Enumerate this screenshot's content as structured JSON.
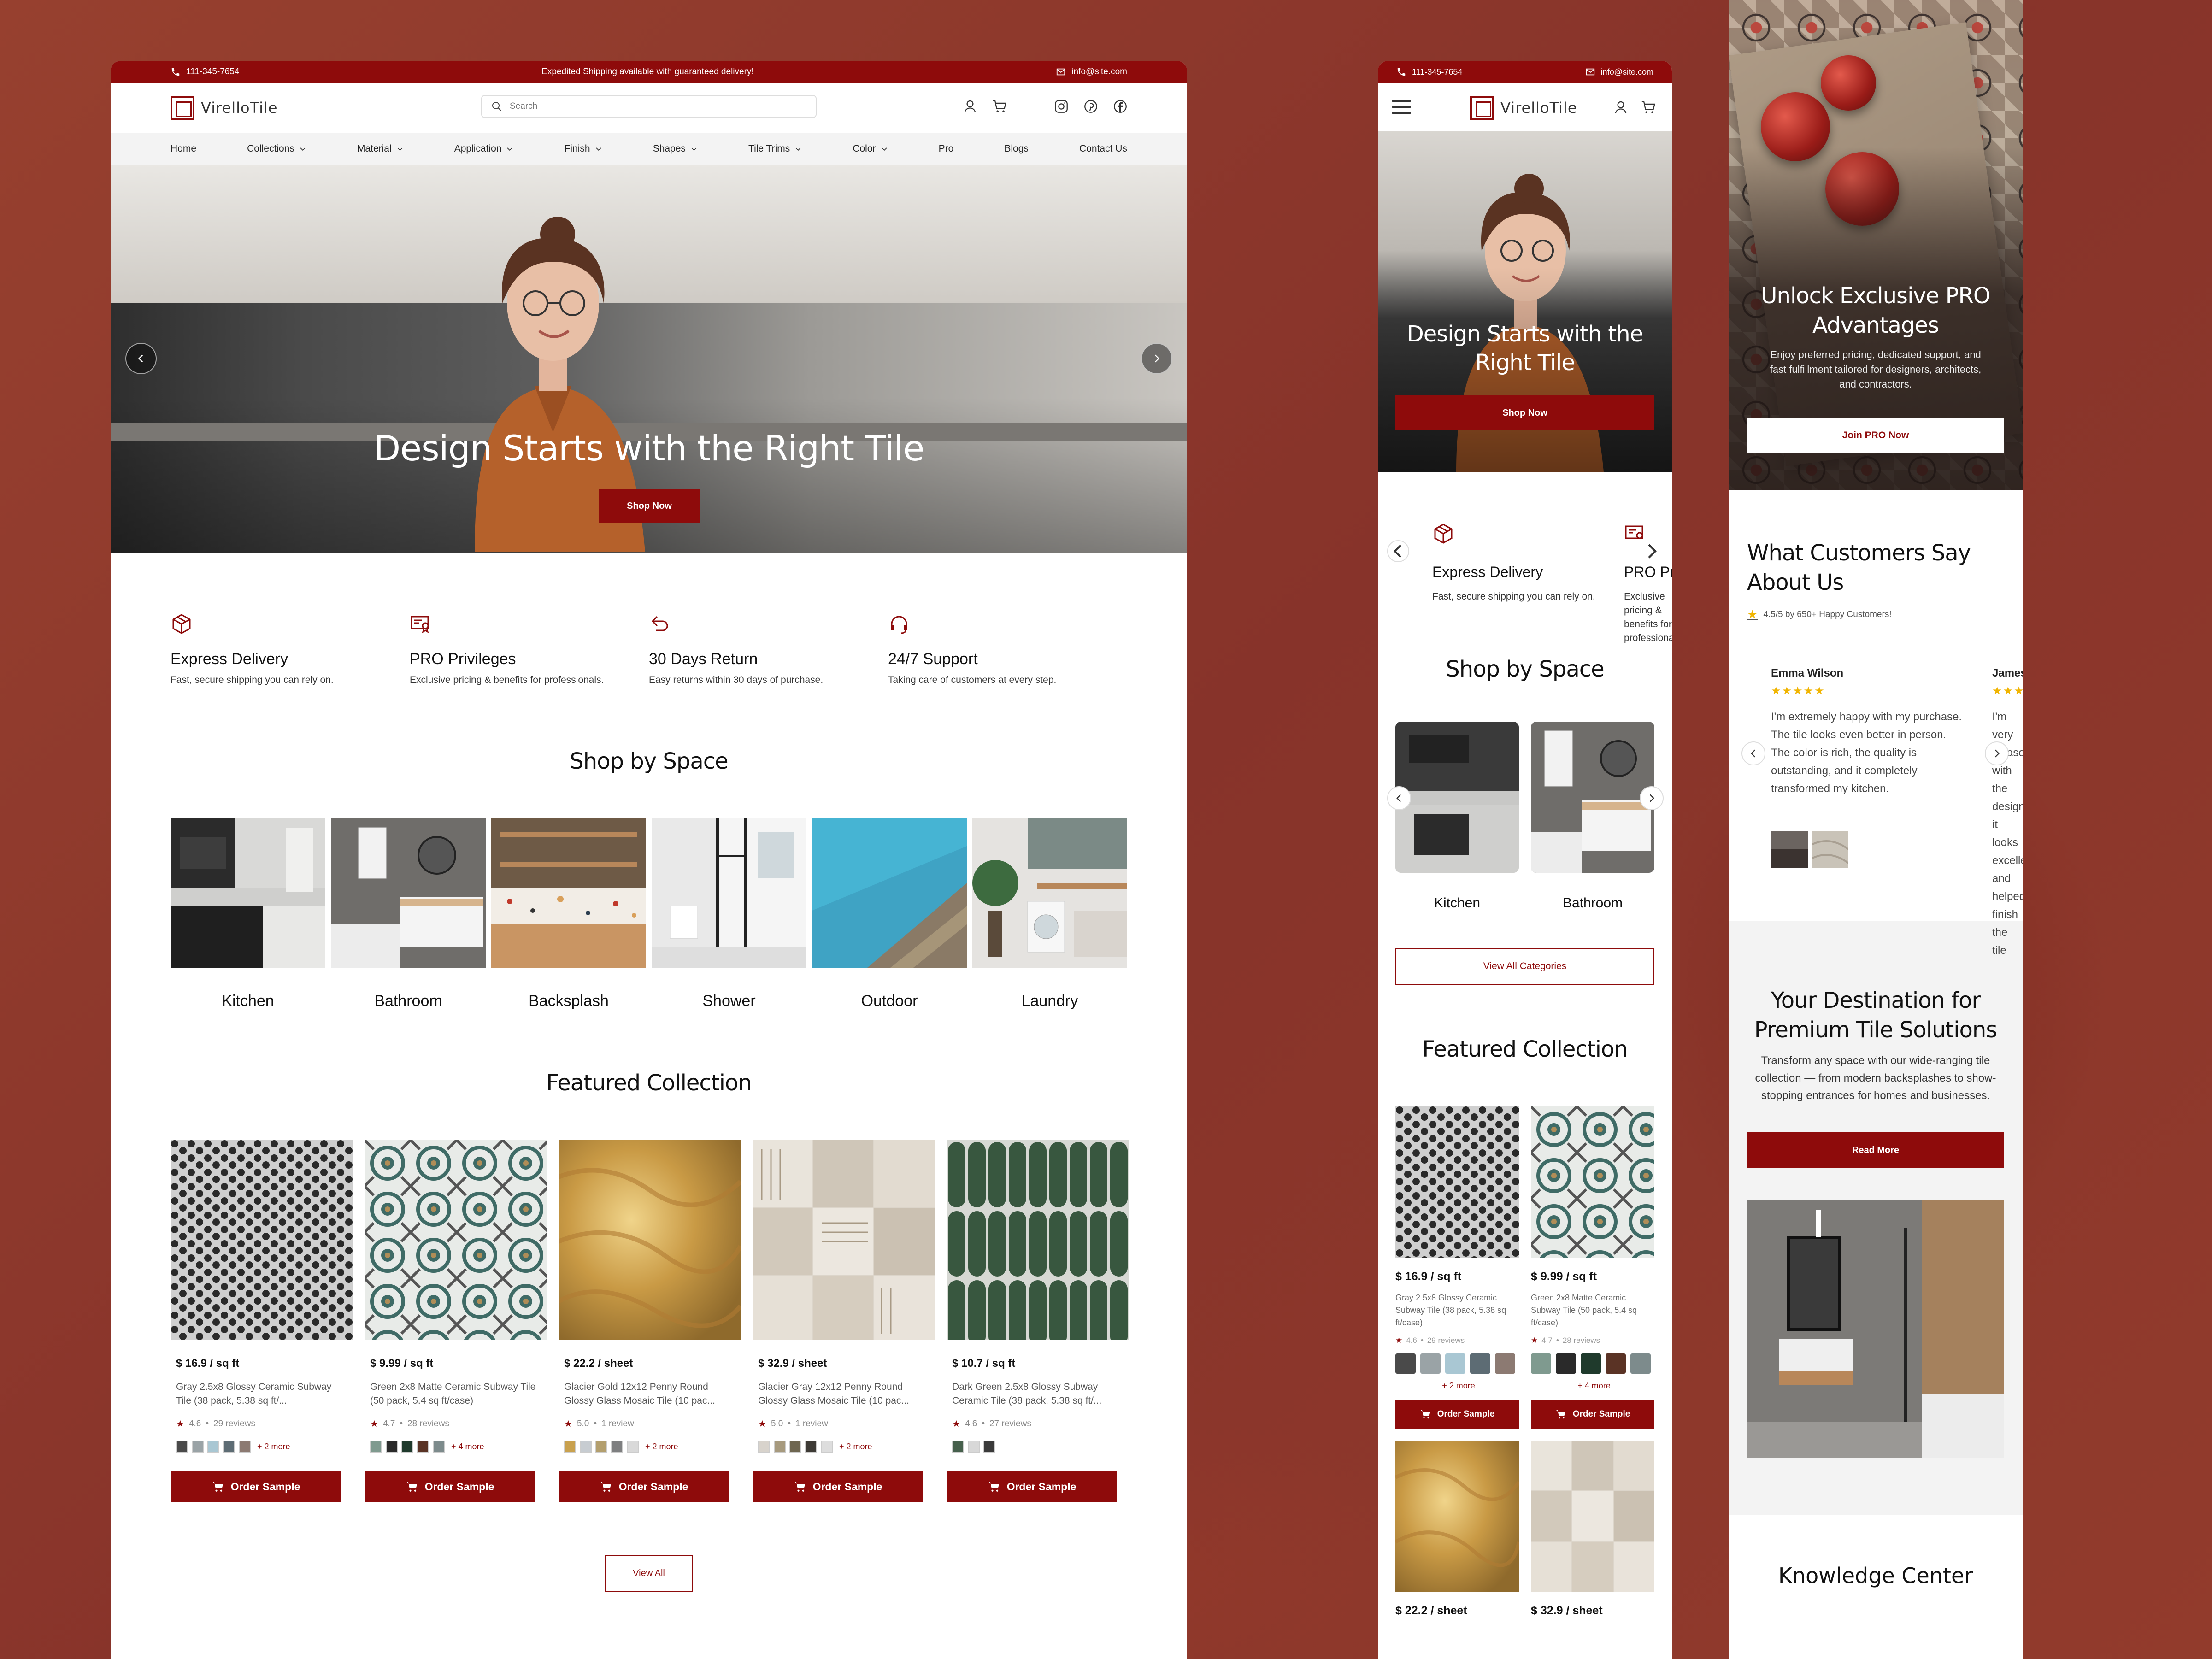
{
  "brand": {
    "name": "VirelloTile",
    "accent": "#8e0b0b"
  },
  "topbar": {
    "phone": "111-345-7654",
    "notice": "Expedited Shipping available with guaranteed delivery!",
    "email": "info@site.com"
  },
  "search": {
    "placeholder": "Search"
  },
  "nav": [
    "Home",
    "Collections",
    "Material",
    "Application",
    "Finish",
    "Shapes",
    "Tile Trims",
    "Color",
    "Pro",
    "Blogs",
    "Contact Us"
  ],
  "hero": {
    "title": "Design Starts with the Right Tile",
    "button": "Shop Now"
  },
  "tablet_hero": {
    "title": "Design Starts with the Right Tile",
    "button": "Shop Now"
  },
  "features": [
    {
      "icon": "box-icon",
      "title": "Express Delivery",
      "desc": "Fast, secure shipping you can rely on."
    },
    {
      "icon": "certificate-icon",
      "title": "PRO Privileges",
      "desc": "Exclusive pricing & benefits for professionals."
    },
    {
      "icon": "return-icon",
      "title": "30 Days Return",
      "desc": "Easy returns within 30 days of purchase."
    },
    {
      "icon": "headset-icon",
      "title": "24/7 Support",
      "desc": "Taking care of customers at every step."
    }
  ],
  "shop_by_space": {
    "title": "Shop by Space",
    "items": [
      "Kitchen",
      "Bathroom",
      "Backsplash",
      "Shower",
      "Outdoor",
      "Laundry"
    ],
    "view_all": "View All Categories"
  },
  "featured": {
    "title": "Featured Collection",
    "view_all": "View All",
    "order_label": "Order Sample",
    "products": [
      {
        "price": "$ 16.9 / sq ft",
        "name": "Gray 2.5x8 Glossy Ceramic Subway Tile (38 pack, 5.38 sq ft/...",
        "tablet_name": "Gray 2.5x8 Glossy Ceramic Subway Tile (38 pack, 5.38 sq ft/case)",
        "rating": "4.6",
        "reviews": "29 reviews",
        "more": "+ 2 more",
        "swatches": [
          "#4a4a4a",
          "#9aa3a6",
          "#a9c7d3",
          "#5d6c74",
          "#8c7a72"
        ]
      },
      {
        "price": "$ 9.99 / sq ft",
        "name": "Green 2x8 Matte Ceramic Subway Tile (50 pack, 5.4 sq ft/case)",
        "tablet_name": "Green 2x8 Matte Ceramic Subway Tile (50 pack, 5.4 sq ft/case)",
        "rating": "4.7",
        "reviews": "28 reviews",
        "more": "+ 4 more",
        "swatches": [
          "#7f9a8f",
          "#2a2a2a",
          "#1f3a2c",
          "#5a3325",
          "#7d8b8c"
        ]
      },
      {
        "price": "$ 22.2 / sheet",
        "name": "Glacier Gold 12x12 Penny Round Glossy Glass Mosaic Tile (10 pac...",
        "rating": "5.0",
        "reviews": "1 review",
        "more": "+ 2 more",
        "swatches": [
          "#c9a14e",
          "#c7ccd1",
          "#b39f6e",
          "#7e7f80",
          "#d9d9d9"
        ]
      },
      {
        "price": "$ 32.9 / sheet",
        "name": "Glacier Gray 12x12 Penny Round Glossy Glass Mosaic Tile (10 pac...",
        "rating": "5.0",
        "reviews": "1 review",
        "more": "+ 2 more",
        "swatches": [
          "#d8d3cc",
          "#a79a7e",
          "#6e6650",
          "#3d3a35",
          "#dddddd"
        ]
      },
      {
        "price": "$ 10.7 / sq ft",
        "name": "Dark Green 2.5x8 Glossy Subway Ceramic Tile (38 pack, 5.38 sq ft/...",
        "rating": "4.6",
        "reviews": "27 reviews",
        "more": "",
        "swatches": [
          "#46604c",
          "#d8d8d8",
          "#3a3a3a"
        ]
      }
    ]
  },
  "pro": {
    "title": "Unlock Exclusive PRO Advantages",
    "desc": "Enjoy preferred pricing, dedicated support, and fast fulfillment tailored for designers, architects, and contractors.",
    "button": "Join PRO Now"
  },
  "testimonials": {
    "title": "What Customers Say About Us",
    "rating": "4.5/5 by 650+ Happy Customers!",
    "items": [
      {
        "name": "Emma Wilson",
        "stars": "★★★★★",
        "text": "I'm extremely happy with my purchase. The tile looks even better in person. The color is rich, the quality is outstanding, and it completely transformed my kitchen."
      },
      {
        "name": "James",
        "stars": "★★★★★",
        "text": "I'm very pleased with the design; it looks excellent and helped finish the tile"
      }
    ]
  },
  "destination": {
    "title": "Your Destination for Premium Tile Solutions",
    "desc": "Transform any space with our wide-ranging tile collection — from modern backsplashes to show-stopping entrances for homes and businesses.",
    "button": "Read More"
  },
  "knowledge": {
    "title": "Knowledge Center"
  }
}
